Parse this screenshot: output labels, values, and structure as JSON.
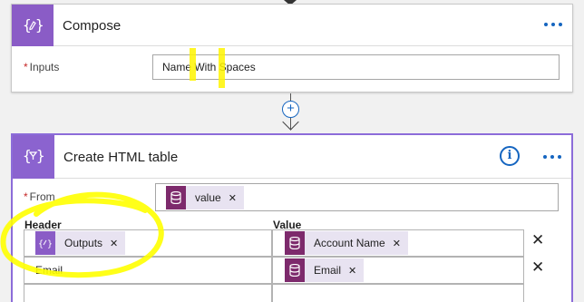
{
  "compose": {
    "title": "Compose",
    "inputs_label": "Inputs",
    "inputs_value": "Name With Spaces"
  },
  "html_table": {
    "title": "Create HTML table",
    "from_label": "From",
    "from_token": "value",
    "header_col": "Header",
    "value_col": "Value",
    "rows": [
      {
        "header_token": "Outputs",
        "value_token": "Account Name"
      },
      {
        "header_text": "Email",
        "value_token": "Email"
      }
    ]
  },
  "icons": {
    "compose": "compose-icon",
    "html_table": "create-html-table-icon",
    "token_db": "database-icon",
    "token_compose": "compose-icon",
    "info": "info-icon",
    "more": "more-icon",
    "add": "plus-icon",
    "remove": "close-icon"
  },
  "colors": {
    "compose_accent": "#8a5cc6",
    "token_db": "#7d2a6c",
    "token_bg": "#e8e3f1",
    "link_blue": "#1565c0",
    "selected_border": "#8c6cd9",
    "highlighter": "#ffff00"
  }
}
